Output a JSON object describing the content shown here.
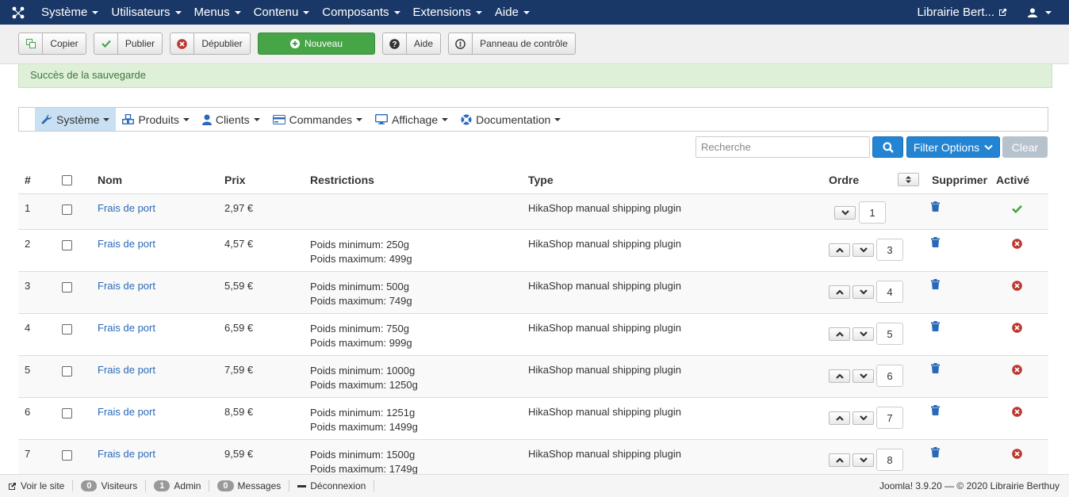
{
  "navbar": {
    "menu": [
      "Système",
      "Utilisateurs",
      "Menus",
      "Contenu",
      "Composants",
      "Extensions",
      "Aide"
    ],
    "site_name": "Librairie Bert...",
    "colors": {
      "background": "#1a3867"
    }
  },
  "toolbar": {
    "copy": "Copier",
    "publish": "Publier",
    "unpublish": "Dépublier",
    "new": "Nouveau",
    "help": "Aide",
    "control_panel": "Panneau de contrôle"
  },
  "alert": {
    "message": "Succès de la sauvegarde"
  },
  "submenu": {
    "items": [
      "Système",
      "Produits",
      "Clients",
      "Commandes",
      "Affichage",
      "Documentation"
    ]
  },
  "filters": {
    "search_placeholder": "Recherche",
    "filter_options": "Filter Options",
    "clear": "Clear"
  },
  "table": {
    "headers": {
      "num": "#",
      "name": "Nom",
      "price": "Prix",
      "restrictions": "Restrictions",
      "type": "Type",
      "order": "Ordre",
      "delete": "Supprimer",
      "active": "Activé"
    },
    "rows": [
      {
        "num": "1",
        "name": "Frais de port",
        "price": "2,97 €",
        "restr1": "",
        "restr2": "",
        "type": "HikaShop manual shipping plugin",
        "order": "1",
        "active": true
      },
      {
        "num": "2",
        "name": "Frais de port",
        "price": "4,57 €",
        "restr1": "Poids minimum: 250g",
        "restr2": "Poids maximum: 499g",
        "type": "HikaShop manual shipping plugin",
        "order": "3",
        "active": false
      },
      {
        "num": "3",
        "name": "Frais de port",
        "price": "5,59 €",
        "restr1": "Poids minimum: 500g",
        "restr2": "Poids maximum: 749g",
        "type": "HikaShop manual shipping plugin",
        "order": "4",
        "active": false
      },
      {
        "num": "4",
        "name": "Frais de port",
        "price": "6,59 €",
        "restr1": "Poids minimum: 750g",
        "restr2": "Poids maximum: 999g",
        "type": "HikaShop manual shipping plugin",
        "order": "5",
        "active": false
      },
      {
        "num": "5",
        "name": "Frais de port",
        "price": "7,59 €",
        "restr1": "Poids minimum: 1000g",
        "restr2": "Poids maximum: 1250g",
        "type": "HikaShop manual shipping plugin",
        "order": "6",
        "active": false
      },
      {
        "num": "6",
        "name": "Frais de port",
        "price": "8,59 €",
        "restr1": "Poids minimum: 1251g",
        "restr2": "Poids maximum: 1499g",
        "type": "HikaShop manual shipping plugin",
        "order": "7",
        "active": false
      },
      {
        "num": "7",
        "name": "Frais de port",
        "price": "9,59 €",
        "restr1": "Poids minimum: 1500g",
        "restr2": "Poids maximum: 1749g",
        "type": "HikaShop manual shipping plugin",
        "order": "8",
        "active": false
      }
    ]
  },
  "statusbar": {
    "view_site": "Voir le site",
    "visitors_count": "0",
    "visitors": "Visiteurs",
    "admin_count": "1",
    "admin": "Admin",
    "messages_count": "0",
    "messages": "Messages",
    "logout": "Déconnexion",
    "footer": "Joomla! 3.9.20 — © 2020 Librairie Berthuy"
  },
  "icons": {
    "active": "check-icon",
    "inactive": "times-circle-icon",
    "delete": "trash-icon"
  }
}
